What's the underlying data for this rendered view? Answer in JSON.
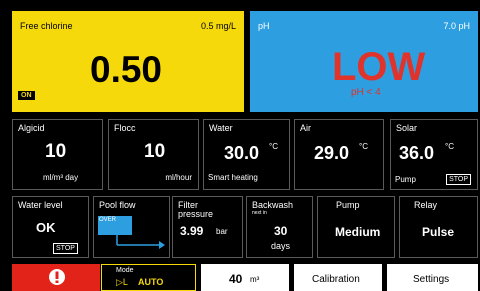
{
  "chlorine": {
    "label": "Free chlorine",
    "reading": "0.5 mg/L",
    "value": "0.50",
    "badge": "ON"
  },
  "ph": {
    "label": "pH",
    "reading": "7.0  pH",
    "status": "LOW",
    "sub": "pH < 4"
  },
  "row2": {
    "algicid": {
      "label": "Algicid",
      "value": "10",
      "unit": "ml/m³ day"
    },
    "flocc": {
      "label": "Flocc",
      "value": "10",
      "unit": "ml/hour"
    },
    "water": {
      "label": "Water",
      "value": "30.0",
      "deg": "°C",
      "note": "Smart heating"
    },
    "air": {
      "label": "Air",
      "value": "29.0",
      "deg": "°C"
    },
    "solar": {
      "label": "Solar",
      "value": "36.0",
      "deg": "°C",
      "note": "Pump",
      "tag": "STOP"
    }
  },
  "row3": {
    "waterlevel": {
      "label": "Water level",
      "value": "OK",
      "tag": "STOP"
    },
    "poolflow": {
      "label": "Pool flow",
      "over": "OVER"
    },
    "filter": {
      "label1": "Filter",
      "label2": "pressure",
      "value": "3.99",
      "unit": "bar"
    },
    "backwash": {
      "label": "Backwash",
      "sub": "next in",
      "value": "30",
      "unit": "days"
    },
    "pump": {
      "label": "Pump",
      "value": "Medium"
    },
    "relay": {
      "label": "Relay",
      "value": "Pulse"
    }
  },
  "bottom": {
    "mode_label": "Mode",
    "mode_value": "AUTO",
    "mode_icon": "▷L",
    "volume_value": "40",
    "volume_unit": "m³",
    "calibration": "Calibration",
    "settings": "Settings"
  },
  "colors": {
    "yellow": "#f5d90a",
    "blue": "#2d9fe0",
    "red": "#e0332b",
    "alarm": "#e2231a"
  }
}
